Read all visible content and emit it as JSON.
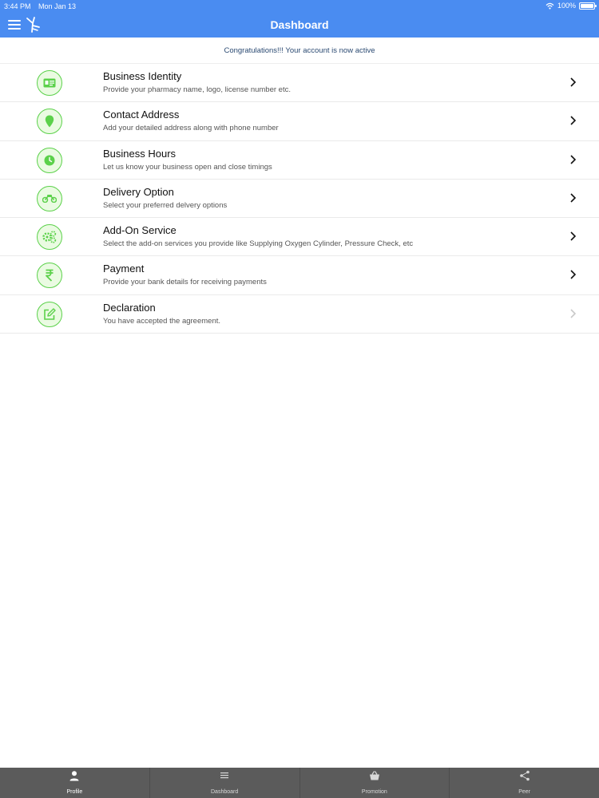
{
  "status_bar": {
    "time": "3:44 PM",
    "date": "Mon Jan 13",
    "battery": "100%"
  },
  "header": {
    "title": "Dashboard"
  },
  "banner": {
    "text": "Congratulations!!! Your account is now active"
  },
  "items": [
    {
      "title": "Business Identity",
      "subtitle": "Provide your pharmacy name, logo, license number etc.",
      "icon": "id-card-icon"
    },
    {
      "title": "Contact Address",
      "subtitle": "Add your detailed address along with phone number",
      "icon": "location-pin-icon"
    },
    {
      "title": "Business Hours",
      "subtitle": "Let us know your business open and close timings",
      "icon": "clock-icon"
    },
    {
      "title": "Delivery Option",
      "subtitle": "Select your preferred delvery options",
      "icon": "motorbike-icon"
    },
    {
      "title": "Add-On Service",
      "subtitle": "Select the add-on services you provide like Supplying Oxygen Cylinder, Pressure Check, etc",
      "icon": "gears-icon"
    },
    {
      "title": "Payment",
      "subtitle": "Provide your bank details for receiving payments",
      "icon": "rupee-icon"
    },
    {
      "title": "Declaration",
      "subtitle": "You have accepted the agreement.",
      "icon": "edit-icon"
    }
  ],
  "tabs": [
    {
      "label": "Profile",
      "icon": "person-icon"
    },
    {
      "label": "Dashboard",
      "icon": "list-icon"
    },
    {
      "label": "Promotion",
      "icon": "basket-icon"
    },
    {
      "label": "Peer",
      "icon": "share-icon"
    }
  ],
  "colors": {
    "header": "#4a8cf1",
    "accent_green": "#5bd14a",
    "tabbar": "#5b5b5b"
  }
}
